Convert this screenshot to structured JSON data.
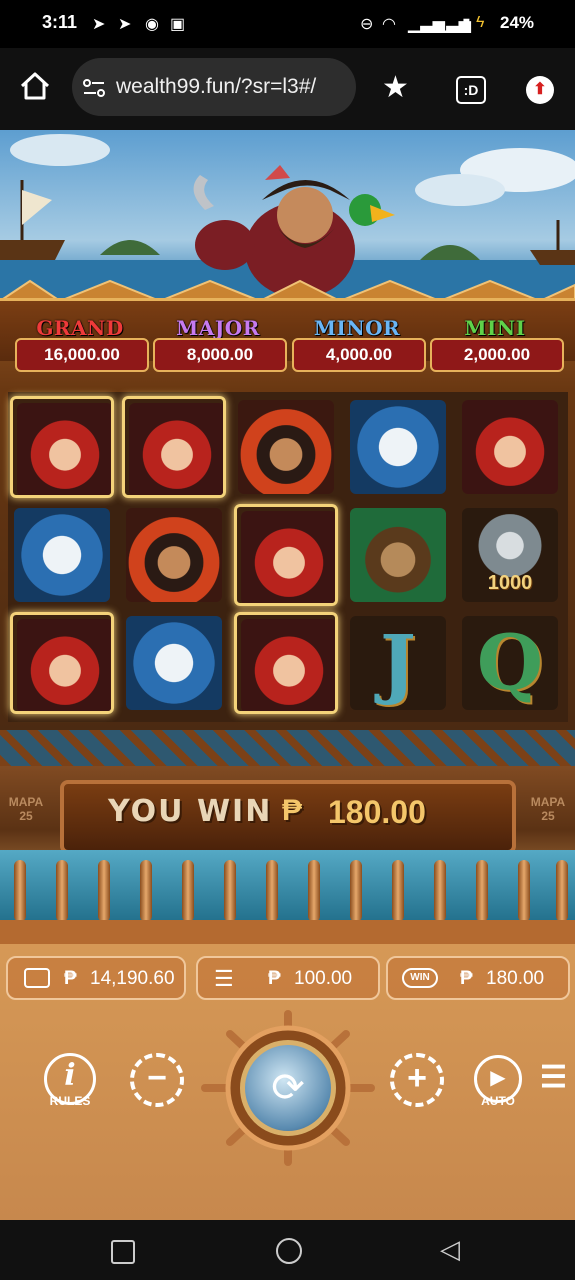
{
  "status_bar": {
    "time": "3:11",
    "battery": "24%",
    "left_icons": [
      "telegram-icon",
      "telegram-icon",
      "app-icon",
      "photo-icon"
    ],
    "right_icons": [
      "dnd-icon",
      "wifi-icon",
      "signal-icon",
      "signal-icon",
      "battery-icon",
      "charging-icon"
    ]
  },
  "browser": {
    "url": "wealth99.fun/?sr=l3#/",
    "icons": [
      "home-icon",
      "site-settings-icon",
      "star-icon",
      "tabs-icon",
      "menu-update-icon"
    ],
    "tabs_label": ":D"
  },
  "jackpots": [
    {
      "label": "GRAND",
      "value": "16,000.00",
      "color": "#e53a3a"
    },
    {
      "label": "MAJOR",
      "value": "8,000.00",
      "color": "#c77bf0"
    },
    {
      "label": "MINOR",
      "value": "4,000.00",
      "color": "#6ab6f5"
    },
    {
      "label": "MINI",
      "value": "2,000.00",
      "color": "#5fd24a"
    }
  ],
  "reels": [
    [
      "pirate-woman",
      "parrot",
      "pirate-woman"
    ],
    [
      "pirate-woman",
      "pirate-captain",
      "parrot"
    ],
    [
      "pirate-captain",
      "pirate-woman",
      "pirate-woman"
    ],
    [
      "parrot",
      "monkey",
      "J"
    ],
    [
      "pirate-woman",
      "coin-1000",
      "Q"
    ]
  ],
  "coin_value": "1000",
  "win": {
    "label": "YOU WIN",
    "currency": "₱",
    "amount": "180.00"
  },
  "side_badges": {
    "left": "MAPA 25",
    "right": "MAPA 25"
  },
  "stats": {
    "balance": "14,190.60",
    "bet": "100.00",
    "win": "180.00",
    "currency": "₱",
    "win_badge": "WIN"
  },
  "controls": {
    "rules_label": "RULES",
    "auto_label": "AUTO",
    "icons": [
      "info-icon",
      "minus-icon",
      "spin-icon",
      "plus-icon",
      "play-icon",
      "menu-icon"
    ]
  },
  "nav": {
    "icons": [
      "recents-icon",
      "home-circle-icon",
      "back-icon"
    ]
  },
  "colors": {
    "gold": "#f4c66a",
    "jackpot_red": "#8f1818",
    "deck_brown": "#c7884d"
  }
}
